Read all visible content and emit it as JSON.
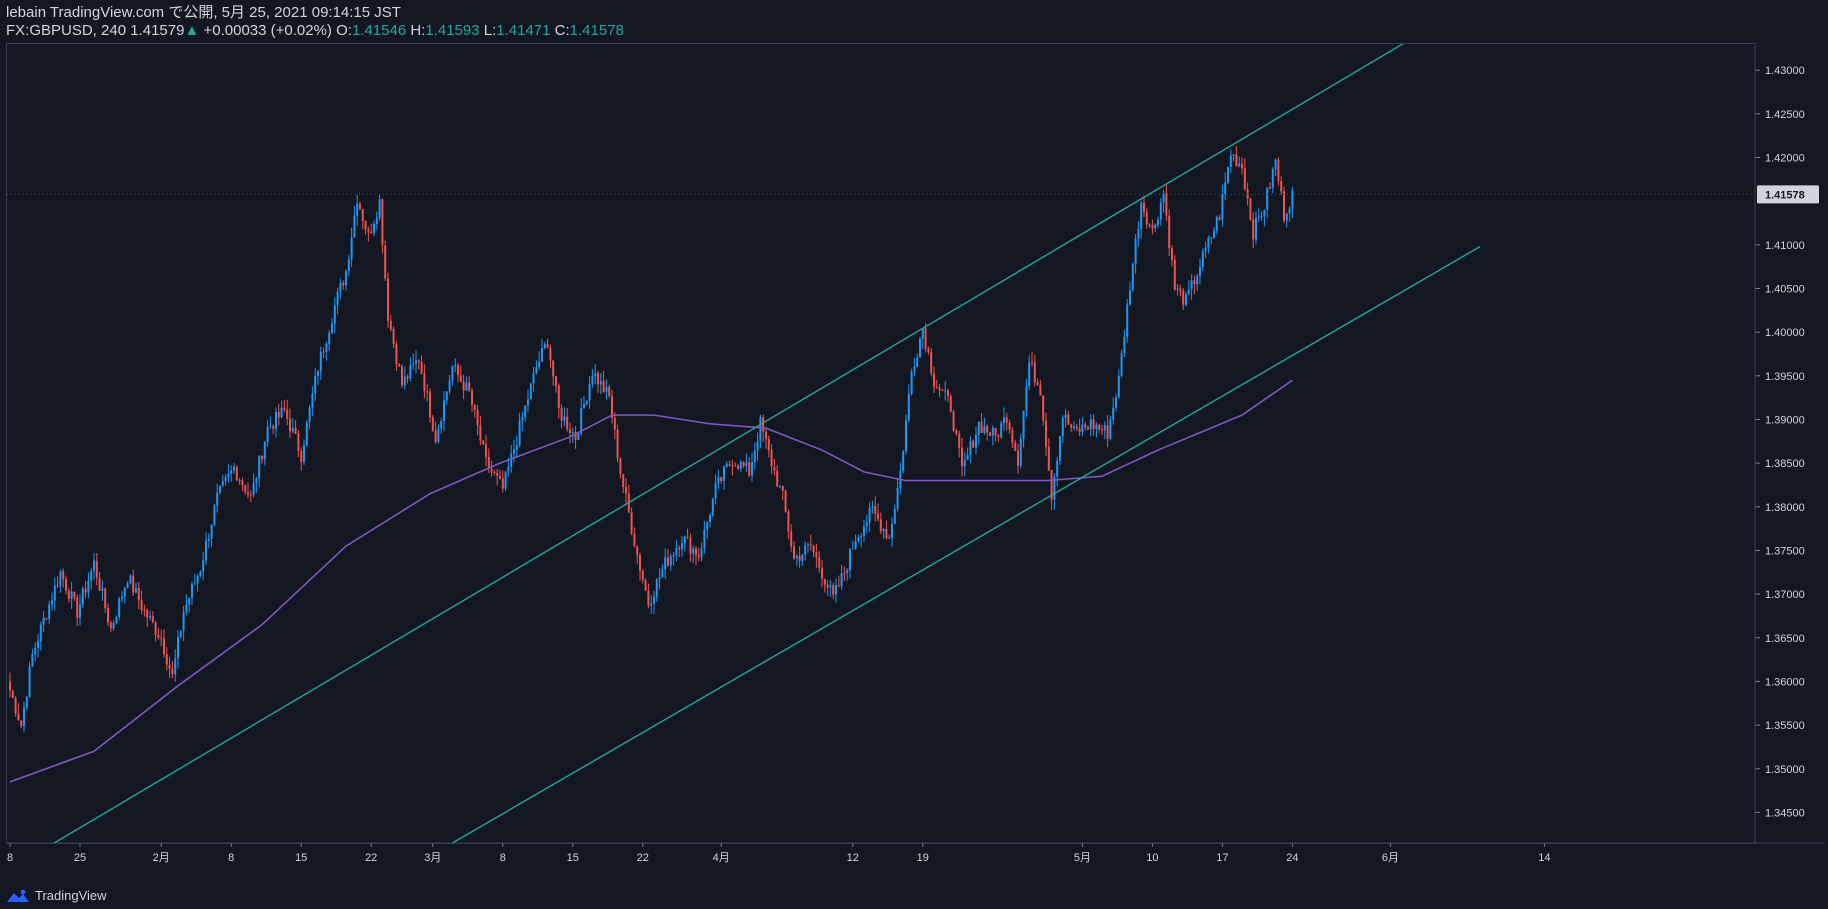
{
  "header": {
    "line1": "lebain TradingView.com で公開, 5月 25, 2021 09:14:15 JST",
    "symbol": "FX:GBPUSD, 240",
    "price": "1.41579",
    "arrow": "▲",
    "change": "+0.00033 (+0.02%)",
    "o_label": "O:",
    "o_val": "1.41546",
    "h_label": "H:",
    "h_val": "1.41593",
    "l_label": "L:",
    "l_val": "1.41471",
    "c_label": "C:",
    "c_val": "1.41578"
  },
  "footer": {
    "brand": "TradingView"
  },
  "colors": {
    "background": "#131722",
    "up": "#2196f3",
    "down": "#ef5350",
    "ma": "#7e57c2",
    "channel": "#26a69a",
    "grid": "#1e2230",
    "text": "#d1d4dc"
  },
  "chart_data": {
    "type": "candlestick",
    "title": "FX:GBPUSD, 240",
    "xlabel": "",
    "ylabel": "",
    "ylim": [
      1.3415,
      1.433
    ],
    "y_ticks": [
      "1.43000",
      "1.42500",
      "1.42000",
      "1.41578",
      "1.41000",
      "1.40500",
      "1.40000",
      "1.39500",
      "1.39000",
      "1.38500",
      "1.38000",
      "1.37500",
      "1.37000",
      "1.36500",
      "1.36000",
      "1.35500",
      "1.35000",
      "1.34500"
    ],
    "x_ticks": [
      "8",
      "25",
      "2月",
      "8",
      "15",
      "22",
      "3月",
      "8",
      "15",
      "22",
      "4月",
      "12",
      "19",
      "5月",
      "10",
      "17",
      "24",
      "6月",
      "14"
    ],
    "current_price_label": "1.41578",
    "close_waypoints": [
      [
        0,
        1.359
      ],
      [
        4,
        1.355
      ],
      [
        8,
        1.363
      ],
      [
        12,
        1.367
      ],
      [
        18,
        1.3725
      ],
      [
        24,
        1.368
      ],
      [
        30,
        1.3735
      ],
      [
        36,
        1.366
      ],
      [
        42,
        1.372
      ],
      [
        48,
        1.368
      ],
      [
        54,
        1.365
      ],
      [
        58,
        1.3605
      ],
      [
        62,
        1.368
      ],
      [
        68,
        1.373
      ],
      [
        74,
        1.381
      ],
      [
        80,
        1.3845
      ],
      [
        86,
        1.381
      ],
      [
        92,
        1.389
      ],
      [
        98,
        1.391
      ],
      [
        104,
        1.386
      ],
      [
        110,
        1.396
      ],
      [
        116,
        1.403
      ],
      [
        120,
        1.407
      ],
      [
        124,
        1.4155
      ],
      [
        128,
        1.411
      ],
      [
        132,
        1.415
      ],
      [
        135,
        1.402
      ],
      [
        140,
        1.394
      ],
      [
        146,
        1.397
      ],
      [
        152,
        1.388
      ],
      [
        158,
        1.396
      ],
      [
        164,
        1.393
      ],
      [
        170,
        1.385
      ],
      [
        176,
        1.382
      ],
      [
        182,
        1.389
      ],
      [
        188,
        1.396
      ],
      [
        192,
        1.399
      ],
      [
        196,
        1.391
      ],
      [
        202,
        1.388
      ],
      [
        208,
        1.3955
      ],
      [
        214,
        1.3925
      ],
      [
        218,
        1.384
      ],
      [
        224,
        1.3745
      ],
      [
        228,
        1.369
      ],
      [
        234,
        1.3735
      ],
      [
        240,
        1.3765
      ],
      [
        246,
        1.3745
      ],
      [
        252,
        1.382
      ],
      [
        258,
        1.3855
      ],
      [
        264,
        1.384
      ],
      [
        268,
        1.3895
      ],
      [
        272,
        1.385
      ],
      [
        276,
        1.381
      ],
      [
        280,
        1.374
      ],
      [
        286,
        1.3755
      ],
      [
        290,
        1.3725
      ],
      [
        294,
        1.3695
      ],
      [
        298,
        1.3725
      ],
      [
        302,
        1.3765
      ],
      [
        308,
        1.3795
      ],
      [
        314,
        1.3765
      ],
      [
        318,
        1.384
      ],
      [
        322,
        1.3955
      ],
      [
        326,
        1.4005
      ],
      [
        330,
        1.3945
      ],
      [
        336,
        1.3915
      ],
      [
        340,
        1.384
      ],
      [
        346,
        1.3895
      ],
      [
        352,
        1.388
      ],
      [
        356,
        1.3905
      ],
      [
        360,
        1.3855
      ],
      [
        364,
        1.3965
      ],
      [
        368,
        1.3935
      ],
      [
        372,
        1.3815
      ],
      [
        376,
        1.3905
      ],
      [
        380,
        1.3885
      ],
      [
        386,
        1.3895
      ],
      [
        392,
        1.3885
      ],
      [
        396,
        1.3945
      ],
      [
        400,
        1.4055
      ],
      [
        404,
        1.415
      ],
      [
        408,
        1.4115
      ],
      [
        412,
        1.416
      ],
      [
        416,
        1.405
      ],
      [
        420,
        1.4035
      ],
      [
        426,
        1.4085
      ],
      [
        432,
        1.4135
      ],
      [
        436,
        1.4205
      ],
      [
        440,
        1.419
      ],
      [
        444,
        1.4115
      ],
      [
        448,
        1.4145
      ],
      [
        452,
        1.4195
      ],
      [
        455,
        1.4135
      ],
      [
        458,
        1.4158
      ]
    ],
    "ma_waypoints": [
      [
        0,
        1.3485
      ],
      [
        30,
        1.352
      ],
      [
        60,
        1.3595
      ],
      [
        90,
        1.3665
      ],
      [
        120,
        1.3755
      ],
      [
        150,
        1.3815
      ],
      [
        175,
        1.385
      ],
      [
        200,
        1.388
      ],
      [
        215,
        1.3905
      ],
      [
        230,
        1.3905
      ],
      [
        250,
        1.3895
      ],
      [
        270,
        1.389
      ],
      [
        290,
        1.3865
      ],
      [
        305,
        1.384
      ],
      [
        320,
        1.383
      ],
      [
        350,
        1.383
      ],
      [
        370,
        1.383
      ],
      [
        390,
        1.3835
      ],
      [
        410,
        1.3865
      ],
      [
        440,
        1.3905
      ],
      [
        458,
        1.3945
      ]
    ],
    "channel_upper": [
      [
        0.0,
        1.3385
      ],
      [
        500.0,
        1.4335
      ]
    ],
    "channel_lower": [
      [
        158.0,
        1.3415
      ],
      [
        525.0,
        1.4098
      ]
    ]
  }
}
